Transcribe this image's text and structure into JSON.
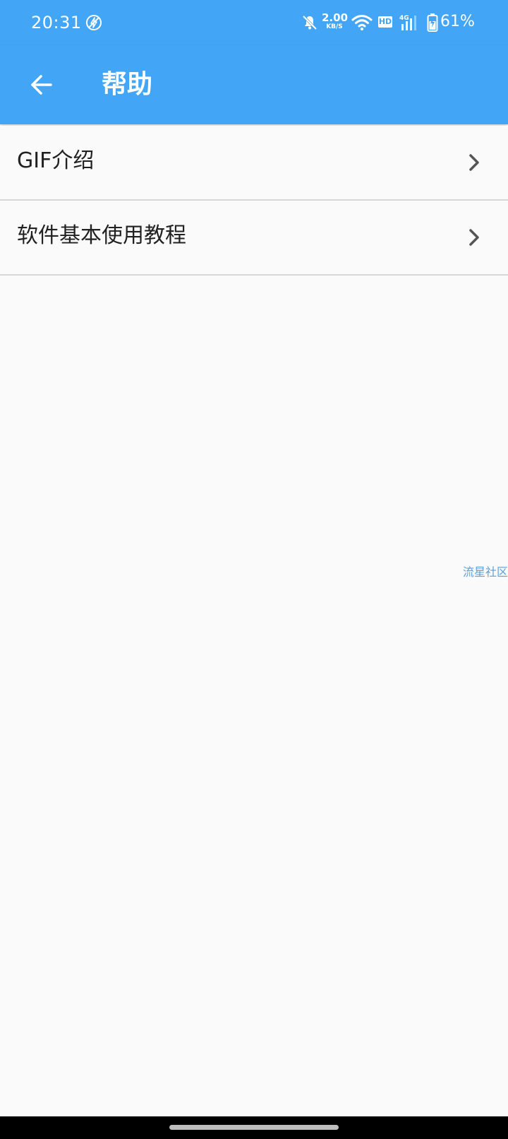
{
  "status_bar": {
    "time": "20:31",
    "net_speed_value": "2.00",
    "net_speed_unit": "KB/S",
    "hd_label": "HD",
    "signal_label": "4G",
    "battery_percent": "61%"
  },
  "app_bar": {
    "title": "帮助",
    "back_icon": "arrow-left-icon"
  },
  "list": {
    "items": [
      {
        "label": "GIF介绍",
        "icon": "chevron-right-icon"
      },
      {
        "label": "软件基本使用教程",
        "icon": "chevron-right-icon"
      }
    ]
  },
  "watermark": "流星社区",
  "colors": {
    "primary": "#42a5f5",
    "background": "#fafafa",
    "text": "#212121",
    "divider": "#d8d8d8",
    "watermark": "#5c9fd8"
  }
}
